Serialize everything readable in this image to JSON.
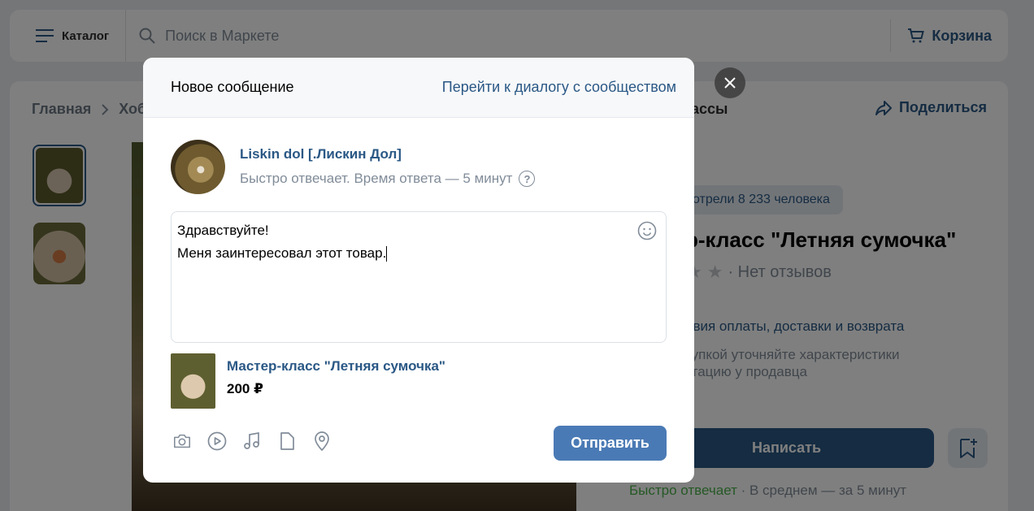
{
  "header": {
    "catalog_label": "Каталог",
    "search_placeholder": "Поиск в Маркете",
    "cart_label": "Корзина"
  },
  "breadcrumbs": {
    "items": [
      "Главная",
      "Хоб"
    ],
    "tail": "ассы"
  },
  "share_label": "Поделиться",
  "product": {
    "views_text": "отрели 8 233 человека",
    "title": "р-класс \"Летняя сумочка\"",
    "rating_text": "· Нет отзывов",
    "terms_link": "овия оплаты, доставки и возврата",
    "note": "купкой уточняйте характеристики\nктацию у продавца",
    "write_button": "Написать",
    "fast_reply_green": "Быстро отвечает",
    "fast_reply_rest": " · В среднем — за 5 минут"
  },
  "modal": {
    "title": "Новое сообщение",
    "dialog_link": "Перейти к диалогу с сообществом",
    "author_name": "Liskin dol [.Лискин Дол]",
    "author_sub": "Быстро отвечает. Время ответа — 5 минут",
    "message_lines": [
      "Здравствуйте!",
      "Меня заинтересовал этот товар."
    ],
    "attachment": {
      "title": "Мастер-класс \"Летняя сумочка\"",
      "price": "200 ₽"
    },
    "send_button": "Отправить",
    "toolbar_icons": [
      "camera-icon",
      "video-icon",
      "music-icon",
      "document-icon",
      "location-icon"
    ]
  },
  "colors": {
    "accent": "#2a5885",
    "send_button": "#4a7ab5",
    "muted": "#818c99",
    "green": "#4bb34b"
  }
}
